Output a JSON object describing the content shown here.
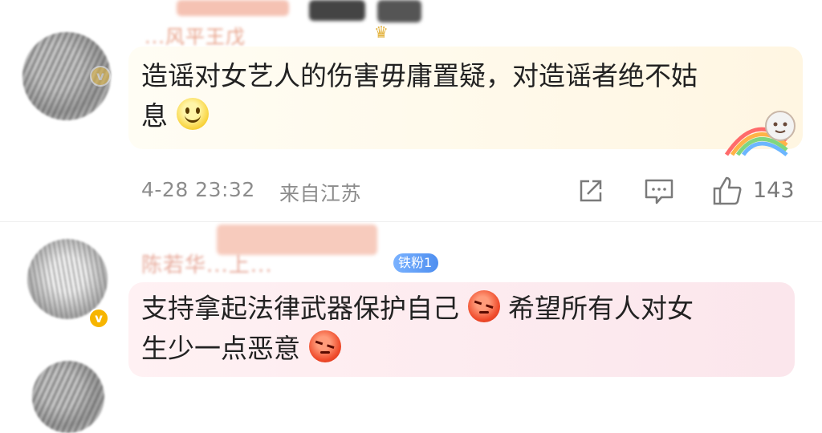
{
  "comments": [
    {
      "username": "...风平王戊",
      "text_line1": "造谣对女艺人的伤害毋庸置疑，对造谣者绝不姑",
      "text_line2": "息",
      "emoji": "smile-icon",
      "date": "4-28 23:32",
      "source": "来自江苏",
      "like_count": "143",
      "bubble_color": "#fffbe6"
    },
    {
      "username": "陈若华...上...",
      "fan_badge": "铁粉1",
      "text_line1": "支持拿起法律武器保护自己",
      "text_line1_after": "希望所有人对女",
      "text_line2": "生少一点恶意",
      "emoji": "angry-icon",
      "bubble_color": "#fcebef",
      "verified_badge": "v"
    }
  ]
}
